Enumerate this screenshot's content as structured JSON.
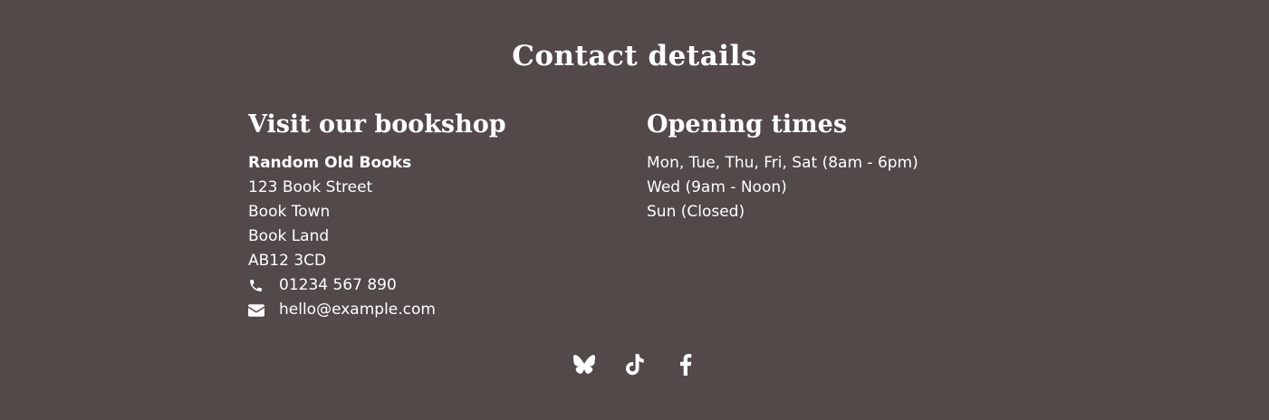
{
  "contact": {
    "title": "Contact details"
  },
  "visit": {
    "heading": "Visit our bookshop",
    "shop_name": "Random Old Books",
    "address": [
      "123 Book Street",
      "Book Town",
      "Book Land",
      "AB12 3CD"
    ],
    "phone": "01234 567 890",
    "email": "hello@example.com"
  },
  "opening": {
    "heading": "Opening times",
    "lines": [
      "Mon, Tue, Thu, Fri, Sat (8am - 6pm)",
      "Wed (9am - Noon)",
      "Sun (Closed)"
    ]
  },
  "social": {
    "icons": [
      "bluesky-icon",
      "tiktok-icon",
      "facebook-icon"
    ]
  },
  "colors": {
    "background": "#524948",
    "text": "#ffffff"
  }
}
